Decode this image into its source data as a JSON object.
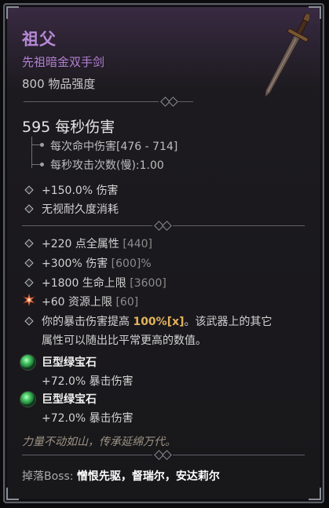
{
  "item": {
    "name": "祖父",
    "type": "先祖暗金双手剑",
    "item_power": "800 物品强度"
  },
  "damage": {
    "dps": "595 每秒伤害",
    "per_hit": "每次命中伤害[476 - 714]",
    "attack_speed": "每秒攻击次数(慢):1.00"
  },
  "implicits": [
    "+150.0% 伤害",
    "无视耐久度消耗"
  ],
  "affixes": [
    {
      "value": "+220 点全属性",
      "range": " [440]"
    },
    {
      "value": "+300% 伤害",
      "range": " [600]%"
    },
    {
      "value": "+1800 生命上限",
      "range": " [3600]"
    },
    {
      "value": "+60 资源上限",
      "range": " [60]"
    }
  ],
  "unique_power": {
    "line1_prefix": "你的暴击伤害提高 ",
    "line1_value": "100%[x]",
    "line1_suffix": "。该武器上的其它",
    "line2": "属性可以随出比平常更高的数值。"
  },
  "sockets": [
    {
      "name": "巨型绿宝石",
      "stat": "+72.0% 暴击伤害"
    },
    {
      "name": "巨型绿宝石",
      "stat": "+72.0% 暴击伤害"
    }
  ],
  "flavor_text": "力量不动如山，传承延绵万代。",
  "drops": {
    "label": "掉落Boss: ",
    "bosses": "憎恨先驱，督瑞尔，安达莉尔"
  },
  "colors": {
    "unique_name": "#b68ad6",
    "highlight": "#e2b25b",
    "gem": "#4fd06a"
  }
}
